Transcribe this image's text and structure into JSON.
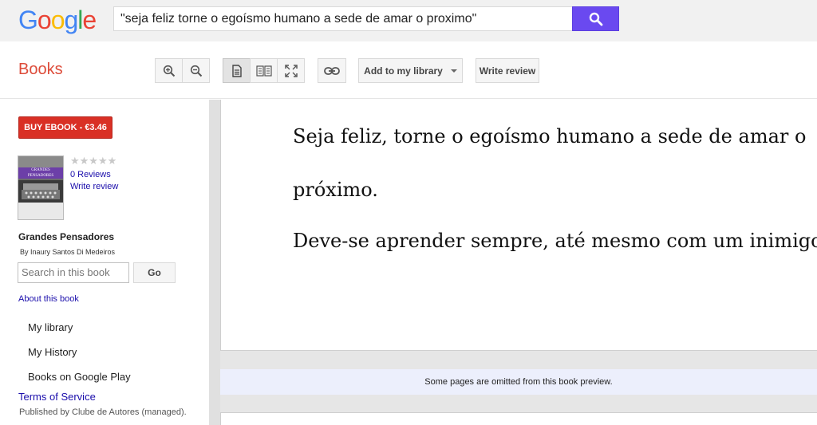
{
  "logo": {
    "letters": [
      "G",
      "o",
      "o",
      "g",
      "l",
      "e"
    ],
    "colors": [
      "#4285f4",
      "#ea4335",
      "#fbbc05",
      "#4285f4",
      "#34a853",
      "#ea4335"
    ]
  },
  "search": {
    "query": "\"seja feliz torne o egoísmo humano a sede de amar o proximo\"",
    "button_icon": "search-icon"
  },
  "toolbar": {
    "section_title": "Books",
    "add_to_library": "Add to my library",
    "write_review": "Write review",
    "icons": [
      "zoom-in-icon",
      "zoom-out-icon",
      "single-page-icon",
      "two-page-icon",
      "fullscreen-icon",
      "link-icon"
    ]
  },
  "sidebar": {
    "buy_button": "BUY EBOOK - €3.46",
    "cover_title": "GRANDES PENSADORES",
    "rating_stars": "★★★★★",
    "reviews": "0 Reviews",
    "write_review": "Write review",
    "book_title": "Grandes Pensadores",
    "author": "By Inaury Santos Di Medeiros",
    "in_book_search_placeholder": "Search in this book",
    "go_button": "Go",
    "about": "About this book",
    "nav": [
      "My library",
      "My History",
      "Books on Google Play"
    ],
    "terms": "Terms of Service",
    "publisher": "Published by Clube de Autores (managed)."
  },
  "viewer": {
    "lines": [
      "Seja feliz, torne o egoísmo humano a sede de amar o",
      "próximo.",
      "Deve-se aprender sempre, até mesmo com um inimigo."
    ],
    "omitted_notice": "Some pages are omitted from this book preview."
  },
  "colors": {
    "accent_search": "#6a49f0",
    "buy_red": "#d93025",
    "books_red": "#dd4b39",
    "link_blue": "#1a0dab"
  }
}
